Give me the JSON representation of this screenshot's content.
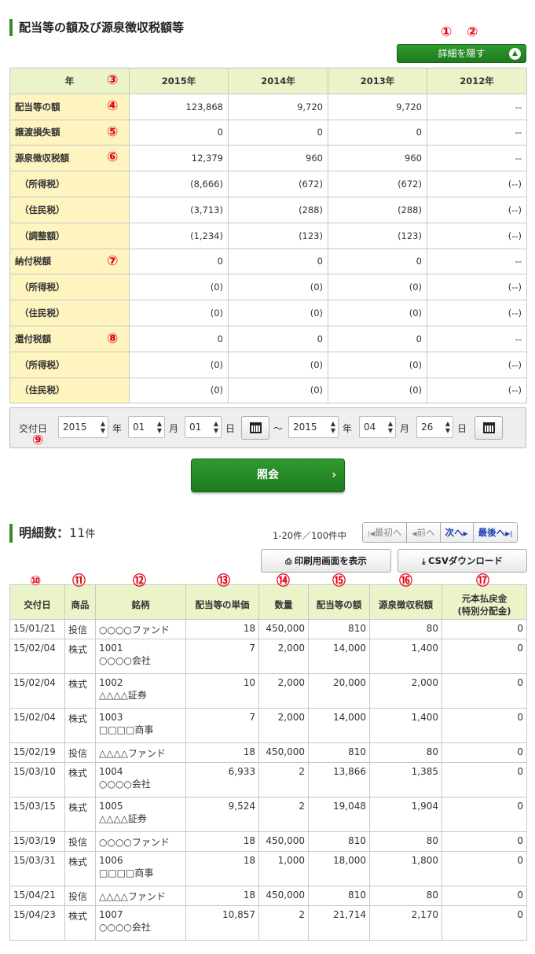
{
  "summary": {
    "title": "配当等の額及び源泉徴収税額等",
    "toggle_label": "詳細を隠す",
    "year_header": "年",
    "years": [
      "2015年",
      "2014年",
      "2013年",
      "2012年"
    ],
    "rows": [
      {
        "label": "配当等の額",
        "values": [
          "123,868",
          "9,720",
          "9,720",
          "--"
        ]
      },
      {
        "label": "譲渡損失額",
        "values": [
          "0",
          "0",
          "0",
          "--"
        ]
      },
      {
        "label": "源泉徴収税額",
        "values": [
          "12,379",
          "960",
          "960",
          "--"
        ]
      },
      {
        "label": "（所得税）",
        "values": [
          "(8,666)",
          "(672)",
          "(672)",
          "(--)"
        ]
      },
      {
        "label": "（住民税）",
        "values": [
          "(3,713)",
          "(288)",
          "(288)",
          "(--)"
        ]
      },
      {
        "label": "（調整額）",
        "values": [
          "(1,234)",
          "(123)",
          "(123)",
          "(--)"
        ]
      },
      {
        "label": "納付税額",
        "values": [
          "0",
          "0",
          "0",
          "--"
        ]
      },
      {
        "label": "（所得税）",
        "values": [
          "(0)",
          "(0)",
          "(0)",
          "(--)"
        ]
      },
      {
        "label": "（住民税）",
        "values": [
          "(0)",
          "(0)",
          "(0)",
          "(--)"
        ]
      },
      {
        "label": "還付税額",
        "values": [
          "0",
          "0",
          "0",
          "--"
        ]
      },
      {
        "label": "（所得税）",
        "values": [
          "(0)",
          "(0)",
          "(0)",
          "(--)"
        ]
      },
      {
        "label": "（住民税）",
        "values": [
          "(0)",
          "(0)",
          "(0)",
          "(--)"
        ]
      }
    ]
  },
  "date_filter": {
    "label": "交付日",
    "from_year": "2015",
    "from_month": "01",
    "from_day": "01",
    "to_year": "2015",
    "to_month": "04",
    "to_day": "26",
    "year_unit": "年",
    "month_unit": "月",
    "day_unit": "日",
    "tilde": "～",
    "submit_label": "照会"
  },
  "list": {
    "count_label": "明細数：",
    "count_value": "11",
    "count_unit": "件",
    "range_text": "1-20件／100件中",
    "pager": {
      "first": "最初へ",
      "prev": "前へ",
      "next": "次へ",
      "last": "最後へ"
    },
    "print_label": "印刷用画面を表示",
    "csv_label": "CSVダウンロード",
    "headers": [
      "交付日",
      "商品",
      "銘柄",
      "配当等の単価",
      "数量",
      "配当等の額",
      "源泉徴収税額",
      "元本払戻金",
      "(特別分配金)"
    ],
    "rows": [
      {
        "date": "15/01/21",
        "product": "投信",
        "name1": "○○○○ファンド",
        "name2": "",
        "unit": "18",
        "qty": "450,000",
        "amount": "810",
        "tax": "80",
        "refund": "0"
      },
      {
        "date": "15/02/04",
        "product": "株式",
        "name1": "1001",
        "name2": "○○○○会社",
        "unit": "7",
        "qty": "2,000",
        "amount": "14,000",
        "tax": "1,400",
        "refund": "0"
      },
      {
        "date": "15/02/04",
        "product": "株式",
        "name1": "1002",
        "name2": "△△△△証券",
        "unit": "10",
        "qty": "2,000",
        "amount": "20,000",
        "tax": "2,000",
        "refund": "0"
      },
      {
        "date": "15/02/04",
        "product": "株式",
        "name1": "1003",
        "name2": "□□□□商事",
        "unit": "7",
        "qty": "2,000",
        "amount": "14,000",
        "tax": "1,400",
        "refund": "0"
      },
      {
        "date": "15/02/19",
        "product": "投信",
        "name1": "△△△△ファンド",
        "name2": "",
        "unit": "18",
        "qty": "450,000",
        "amount": "810",
        "tax": "80",
        "refund": "0"
      },
      {
        "date": "15/03/10",
        "product": "株式",
        "name1": "1004",
        "name2": "○○○○会社",
        "unit": "6,933",
        "qty": "2",
        "amount": "13,866",
        "tax": "1,385",
        "refund": "0"
      },
      {
        "date": "15/03/15",
        "product": "株式",
        "name1": "1005",
        "name2": "△△△△証券",
        "unit": "9,524",
        "qty": "2",
        "amount": "19,048",
        "tax": "1,904",
        "refund": "0"
      },
      {
        "date": "15/03/19",
        "product": "投信",
        "name1": "○○○○ファンド",
        "name2": "",
        "unit": "18",
        "qty": "450,000",
        "amount": "810",
        "tax": "80",
        "refund": "0"
      },
      {
        "date": "15/03/31",
        "product": "株式",
        "name1": "1006",
        "name2": "□□□□商事",
        "unit": "18",
        "qty": "1,000",
        "amount": "18,000",
        "tax": "1,800",
        "refund": "0"
      },
      {
        "date": "15/04/21",
        "product": "投信",
        "name1": "△△△△ファンド",
        "name2": "",
        "unit": "18",
        "qty": "450,000",
        "amount": "810",
        "tax": "80",
        "refund": "0"
      },
      {
        "date": "15/04/23",
        "product": "株式",
        "name1": "1007",
        "name2": "○○○○会社",
        "unit": "10,857",
        "qty": "2",
        "amount": "21,714",
        "tax": "2,170",
        "refund": "0"
      }
    ]
  },
  "markers": [
    "①",
    "②",
    "③",
    "④",
    "⑤",
    "⑥",
    "⑦",
    "⑧",
    "⑨",
    "⑩",
    "⑪",
    "⑫",
    "⑬",
    "⑭",
    "⑮",
    "⑯",
    "⑰"
  ],
  "colors": {
    "accent_green": "#1e7a1e",
    "header_bg": "#eaf4c8",
    "label_bg": "#fdf4bf",
    "marker_red": "#e60012",
    "link_blue": "#1a3fae"
  }
}
